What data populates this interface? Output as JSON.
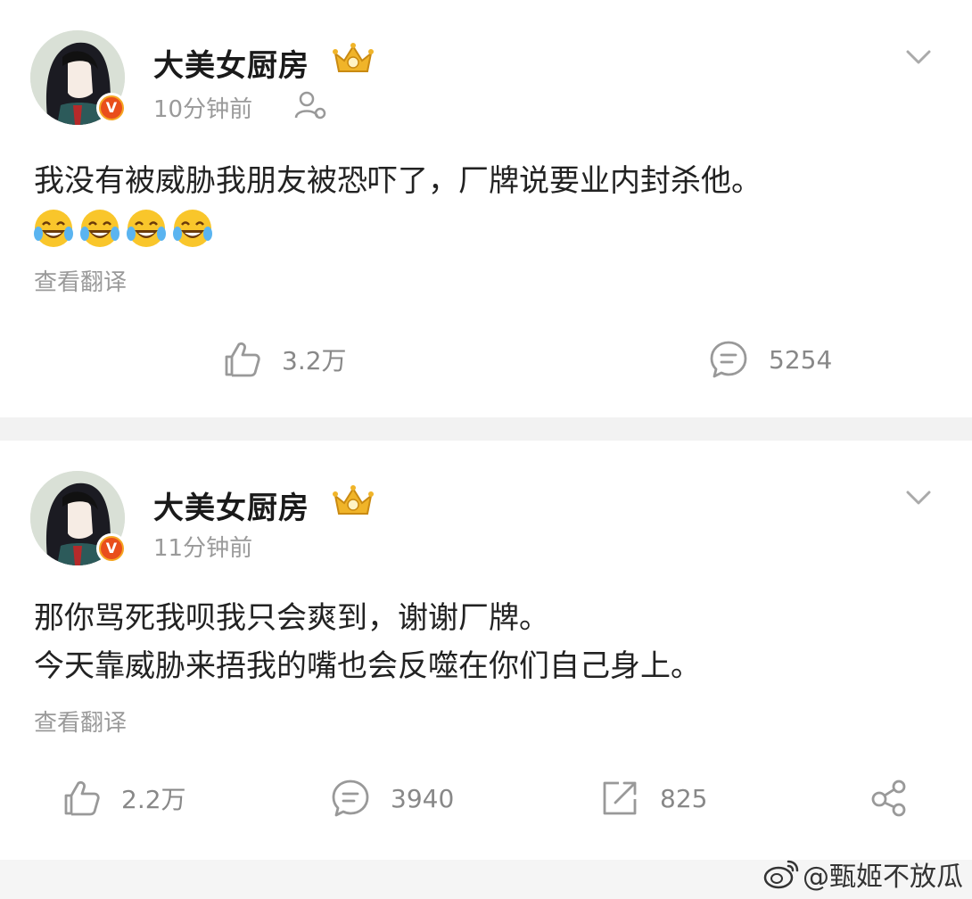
{
  "posts": [
    {
      "username": "大美女厨房",
      "time": "10分钟前",
      "content_lines": [
        "我没有被威胁我朋友被恐吓了，厂牌说要业内封杀他。"
      ],
      "emoji_count": 4,
      "translate_label": "查看翻译",
      "actions": {
        "like_count": "3.2万",
        "comment_count": "5254"
      }
    },
    {
      "username": "大美女厨房",
      "time": "11分钟前",
      "content_lines": [
        "那你骂死我呗我只会爽到，谢谢厂牌。",
        "今天靠威胁来捂我的嘴也会反噬在你们自己身上。"
      ],
      "translate_label": "查看翻译",
      "actions": {
        "like_count": "2.2万",
        "comment_count": "3940",
        "repost_count": "825"
      }
    }
  ],
  "watermark": {
    "text": "@甄姬不放瓜"
  },
  "colors": {
    "accent_badge": "#e94e1b",
    "badge_ring": "#f5a623",
    "meta_text": "#9a9a9a",
    "divider": "#f2f2f2"
  }
}
